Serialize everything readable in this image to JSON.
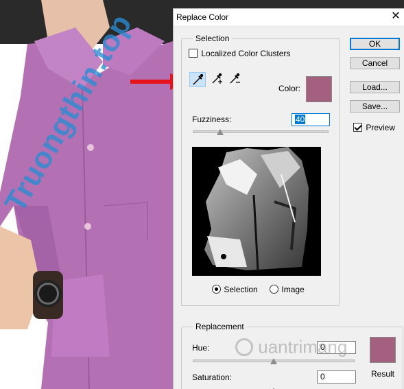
{
  "dialog": {
    "title": "Replace Color",
    "close_glyph": "✕"
  },
  "buttons": {
    "ok": "OK",
    "cancel": "Cancel",
    "load": "Load...",
    "save": "Save..."
  },
  "preview": {
    "label": "Preview",
    "checked": true
  },
  "selection": {
    "legend": "Selection",
    "localized_label": "Localized Color Clusters",
    "localized_checked": false,
    "color_label": "Color:",
    "color_hex": "#a3607f",
    "tools": [
      "eyedropper-icon",
      "eyedropper-plus-icon",
      "eyedropper-minus-icon"
    ],
    "fuzziness_label": "Fuzziness:",
    "fuzziness_value": "40",
    "fuzziness_fraction": 0.2,
    "radio_selection": "Selection",
    "radio_image": "Image",
    "selected_mode": "Selection"
  },
  "replacement": {
    "legend": "Replacement",
    "hue_label": "Hue:",
    "hue_value": "0",
    "saturation_label": "Saturation:",
    "saturation_value": "0",
    "result_label": "Result",
    "result_hex": "#a3607f"
  },
  "watermarks": {
    "left": "Truongthin.top",
    "right": "uantrimang"
  },
  "colors": {
    "shirt": "#b371b3",
    "arrow": "#e8121a",
    "accent": "#0078d7"
  }
}
